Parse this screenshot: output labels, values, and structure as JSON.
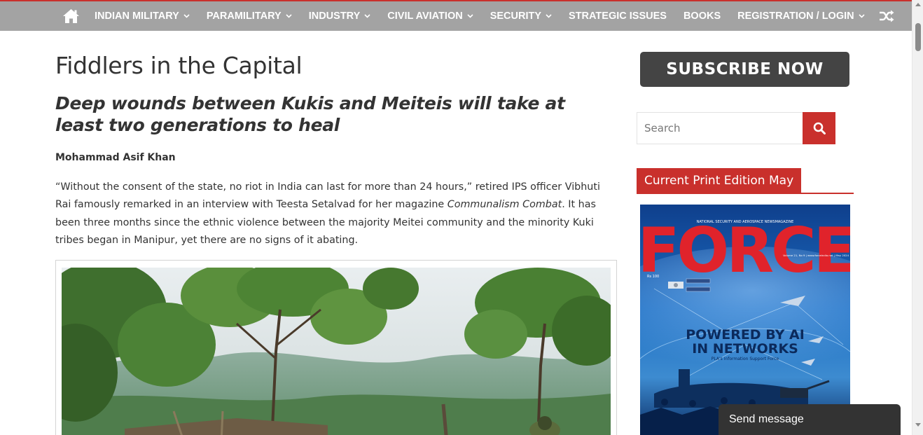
{
  "nav": {
    "home_icon": "home-icon",
    "items": [
      {
        "label": "INDIAN MILITARY",
        "has_dropdown": true
      },
      {
        "label": "PARAMILITARY",
        "has_dropdown": true
      },
      {
        "label": "INDUSTRY",
        "has_dropdown": true
      },
      {
        "label": "CIVIL AVIATION",
        "has_dropdown": true
      },
      {
        "label": "SECURITY",
        "has_dropdown": true
      },
      {
        "label": "STRATEGIC ISSUES",
        "has_dropdown": false
      },
      {
        "label": "BOOKS",
        "has_dropdown": false
      },
      {
        "label": "REGISTRATION / LOGIN",
        "has_dropdown": true
      }
    ],
    "shuffle_icon": "shuffle-icon"
  },
  "article": {
    "title": "Fiddlers in the Capital",
    "subtitle": "Deep wounds between Kukis and Meiteis will take at least two generations to heal",
    "author": "Mohammad Asif Khan",
    "lead_part1": "“Without the consent of the state, no riot in India can last for more than 24 hours,” retired IPS officer Vibhuti Rai famously remarked in an interview with Teesta Setalvad for her magazine ",
    "lead_em": "Communalism Combat",
    "lead_part2": ". It has been three months since the ethnic violence between the majority Meitei community and the minority Kuki tribes began in Manipur, yet there are no signs of it abating."
  },
  "sidebar": {
    "subscribe_label": "SUBSCRIBE NOW",
    "search_placeholder": "Search",
    "search_icon": "search-icon",
    "edition_label": "Current Print Edition May",
    "cover": {
      "masthead": "FORCE",
      "tagline": "NATIONAL SECURITY AND AEROSPACE NEWSMAGAZINE",
      "price": "Rs 100",
      "issue": "Volume 21, No 9 | www.forceindia.net | May 2024",
      "headline_line1": "POWERED BY AI",
      "headline_line2": "IN NETWORKS",
      "subhead": "PLA's Information Support Force"
    }
  },
  "chat": {
    "label": "Send message"
  },
  "colors": {
    "accent": "#c9302c",
    "nav_bg": "#a3a3a3",
    "button_dark": "#444444"
  }
}
